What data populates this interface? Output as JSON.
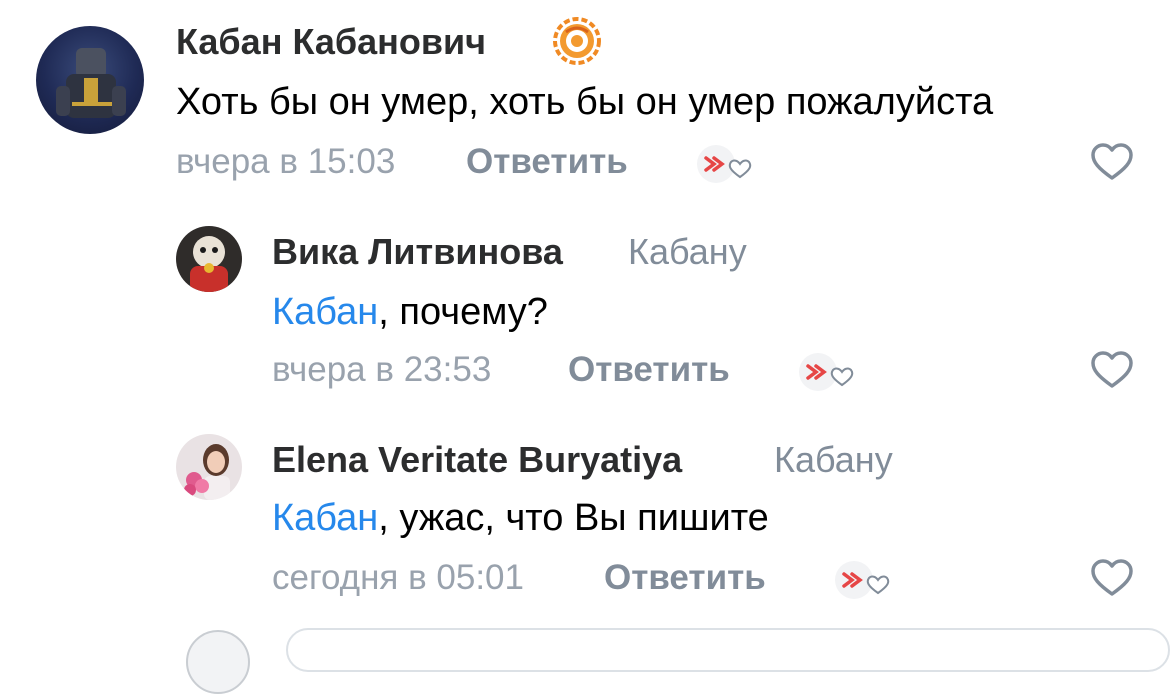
{
  "comments": [
    {
      "author": "Кабан Кабанович",
      "text": "Хоть бы он умер, хоть бы он умер пожалуйста",
      "time": "вчера в 15:03",
      "reply_label": "Ответить"
    },
    {
      "author": "Вика Литвинова",
      "reply_to": "Кабану",
      "mention": "Кабан",
      "text": ", почему?",
      "time": "вчера в 23:53",
      "reply_label": "Ответить"
    },
    {
      "author": "Elena Veritate Buryatiya",
      "reply_to": "Кабану",
      "mention": "Кабан",
      "text": ", ужас, что Вы пишите",
      "time": "сегодня в 05:01",
      "reply_label": "Ответить"
    }
  ],
  "icons": {
    "reaction": "reaction-icon",
    "like": "heart-outline-icon",
    "badge": "donut-badge-icon"
  },
  "colors": {
    "name": "#2c2d2e",
    "secondary": "#818c99",
    "time": "#99a2ad",
    "mention": "#2688eb",
    "reaction_red": "#e64646"
  }
}
